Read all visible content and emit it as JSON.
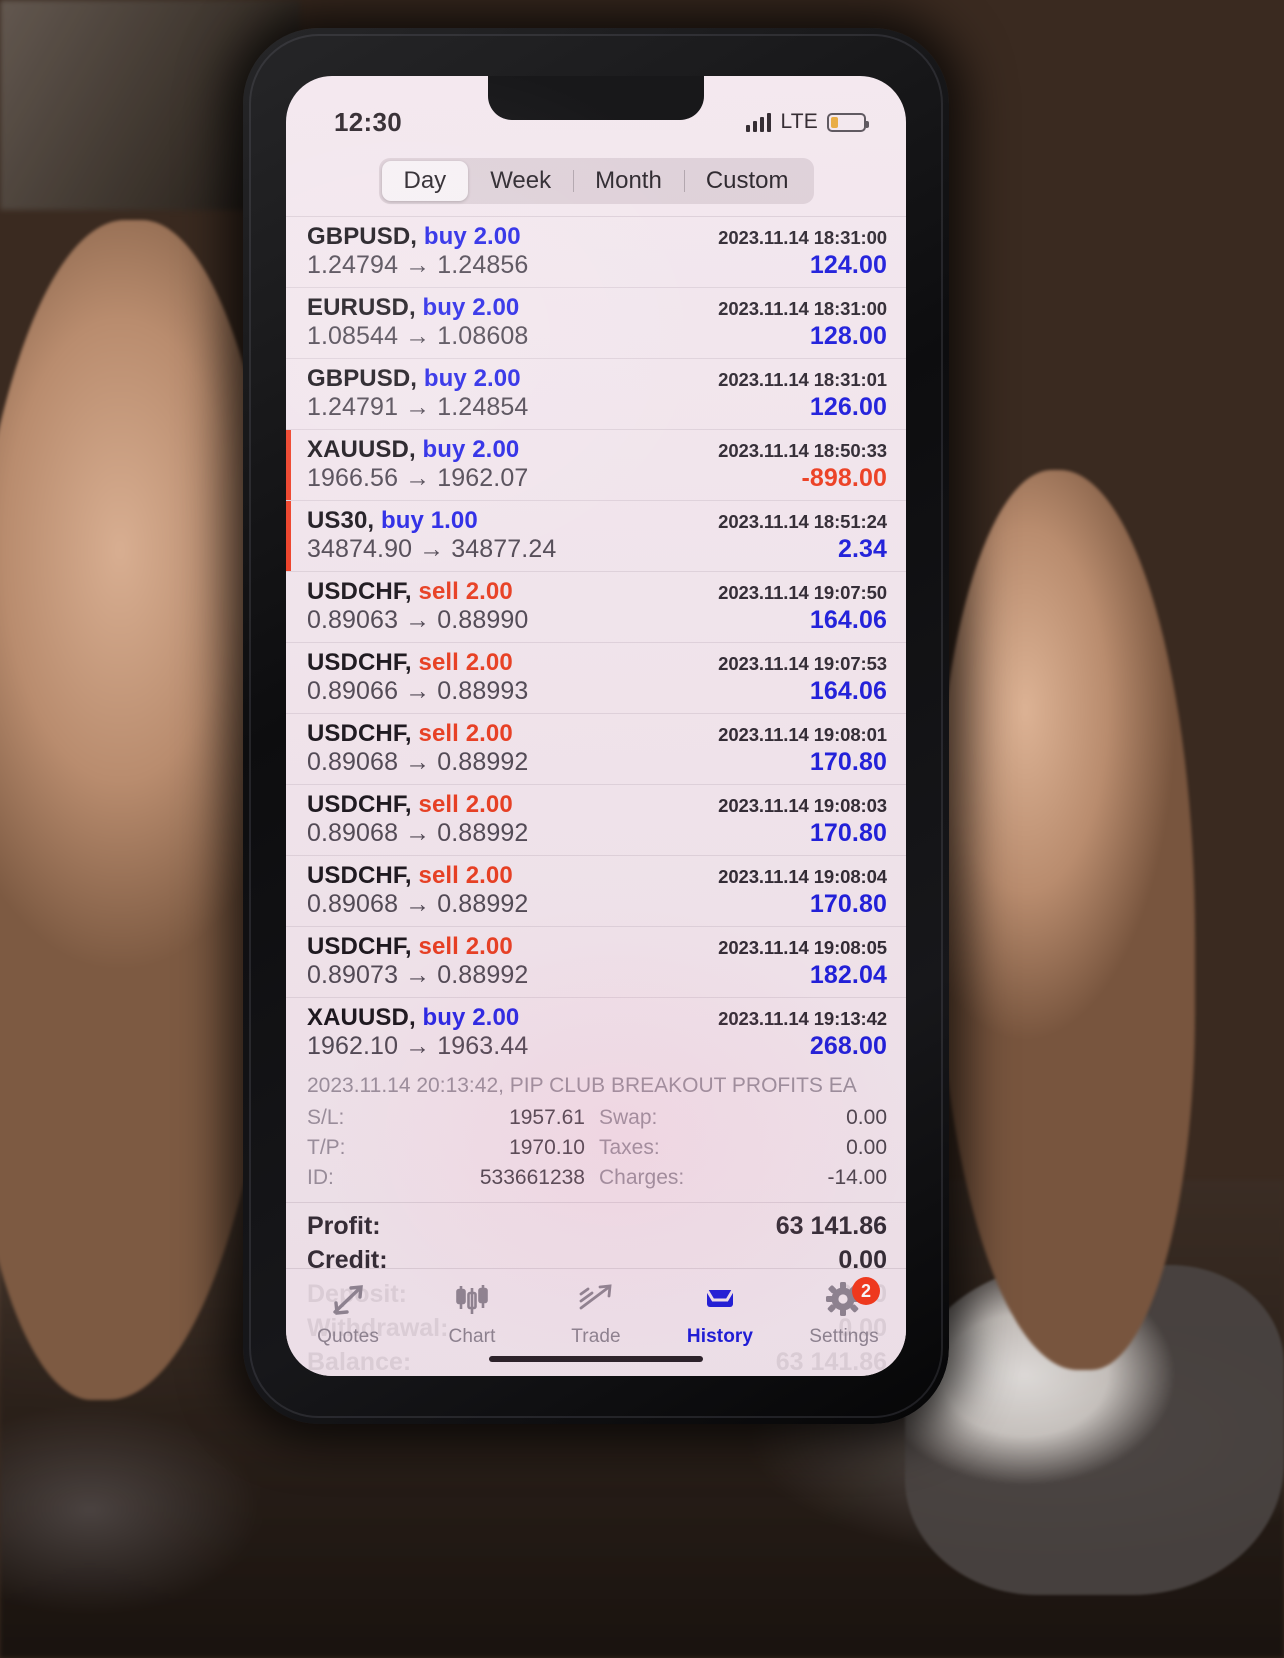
{
  "status_bar": {
    "time": "12:30",
    "network": "LTE",
    "signal_icon": "signal-bars-icon",
    "battery_icon": "battery-low-icon"
  },
  "period_filter": {
    "options": [
      "Day",
      "Week",
      "Month",
      "Custom"
    ],
    "selected": "Day"
  },
  "deals": [
    {
      "symbol": "GBPUSD,",
      "direction": "buy",
      "direction_label": "buy 2.00",
      "timestamp": "2023.11.14 18:31:00",
      "prices": "1.24794 → 1.24856",
      "profit": "124.00",
      "profit_sign": "pos",
      "flagged": false
    },
    {
      "symbol": "EURUSD,",
      "direction": "buy",
      "direction_label": "buy 2.00",
      "timestamp": "2023.11.14 18:31:00",
      "prices": "1.08544 → 1.08608",
      "profit": "128.00",
      "profit_sign": "pos",
      "flagged": false
    },
    {
      "symbol": "GBPUSD,",
      "direction": "buy",
      "direction_label": "buy 2.00",
      "timestamp": "2023.11.14 18:31:01",
      "prices": "1.24791 → 1.24854",
      "profit": "126.00",
      "profit_sign": "pos",
      "flagged": false
    },
    {
      "symbol": "XAUUSD,",
      "direction": "buy",
      "direction_label": "buy 2.00",
      "timestamp": "2023.11.14 18:50:33",
      "prices": "1966.56 → 1962.07",
      "profit": "-898.00",
      "profit_sign": "neg",
      "flagged": true
    },
    {
      "symbol": "US30,",
      "direction": "buy",
      "direction_label": "buy 1.00",
      "timestamp": "2023.11.14 18:51:24",
      "prices": "34874.90 → 34877.24",
      "profit": "2.34",
      "profit_sign": "pos",
      "flagged": true
    },
    {
      "symbol": "USDCHF,",
      "direction": "sell",
      "direction_label": "sell 2.00",
      "timestamp": "2023.11.14 19:07:50",
      "prices": "0.89063 → 0.88990",
      "profit": "164.06",
      "profit_sign": "pos",
      "flagged": false
    },
    {
      "symbol": "USDCHF,",
      "direction": "sell",
      "direction_label": "sell 2.00",
      "timestamp": "2023.11.14 19:07:53",
      "prices": "0.89066 → 0.88993",
      "profit": "164.06",
      "profit_sign": "pos",
      "flagged": false
    },
    {
      "symbol": "USDCHF,",
      "direction": "sell",
      "direction_label": "sell 2.00",
      "timestamp": "2023.11.14 19:08:01",
      "prices": "0.89068 → 0.88992",
      "profit": "170.80",
      "profit_sign": "pos",
      "flagged": false
    },
    {
      "symbol": "USDCHF,",
      "direction": "sell",
      "direction_label": "sell 2.00",
      "timestamp": "2023.11.14 19:08:03",
      "prices": "0.89068 → 0.88992",
      "profit": "170.80",
      "profit_sign": "pos",
      "flagged": false
    },
    {
      "symbol": "USDCHF,",
      "direction": "sell",
      "direction_label": "sell 2.00",
      "timestamp": "2023.11.14 19:08:04",
      "prices": "0.89068 → 0.88992",
      "profit": "170.80",
      "profit_sign": "pos",
      "flagged": false
    },
    {
      "symbol": "USDCHF,",
      "direction": "sell",
      "direction_label": "sell 2.00",
      "timestamp": "2023.11.14 19:08:05",
      "prices": "0.89073 → 0.88992",
      "profit": "182.04",
      "profit_sign": "pos",
      "flagged": false
    },
    {
      "symbol": "XAUUSD,",
      "direction": "buy",
      "direction_label": "buy 2.00",
      "timestamp": "2023.11.14 19:13:42",
      "prices": "1962.10 → 1963.44",
      "profit": "268.00",
      "profit_sign": "pos",
      "flagged": false,
      "expanded": true
    }
  ],
  "expanded_detail": {
    "origin": "2023.11.14 20:13:42, PIP CLUB BREAKOUT PROFITS EA",
    "rows": [
      {
        "label": "S/L:",
        "value": "1957.61",
        "label2": "Swap:",
        "value2": "0.00"
      },
      {
        "label": "T/P:",
        "value": "1970.10",
        "label2": "Taxes:",
        "value2": "0.00"
      },
      {
        "label": "ID:",
        "value": "533661238",
        "label2": "Charges:",
        "value2": "-14.00"
      }
    ]
  },
  "summary": [
    {
      "label": "Profit:",
      "value": "63 141.86"
    },
    {
      "label": "Credit:",
      "value": "0.00"
    },
    {
      "label": "Deposit:",
      "value": "0.00"
    },
    {
      "label": "Withdrawal:",
      "value": "0.00"
    },
    {
      "label": "Balance:",
      "value": "63 141.86"
    }
  ],
  "tabs": [
    {
      "label": "Quotes",
      "icon": "quotes-arrows-icon",
      "active": false
    },
    {
      "label": "Chart",
      "icon": "candlestick-chart-icon",
      "active": false
    },
    {
      "label": "Trade",
      "icon": "trade-trend-icon",
      "active": false
    },
    {
      "label": "History",
      "icon": "history-inbox-icon",
      "active": true
    },
    {
      "label": "Settings",
      "icon": "gear-icon",
      "active": false,
      "badge": "2"
    }
  ],
  "colors": {
    "buy": "#2323e8",
    "sell": "#ea3c1e",
    "profit_positive": "#1b1bdc",
    "profit_negative": "#ee3c1e",
    "accent": "#1b1bdc",
    "badge": "#f5391b",
    "flag": "#f03c22",
    "screen_bg": "#f3e7ee"
  }
}
